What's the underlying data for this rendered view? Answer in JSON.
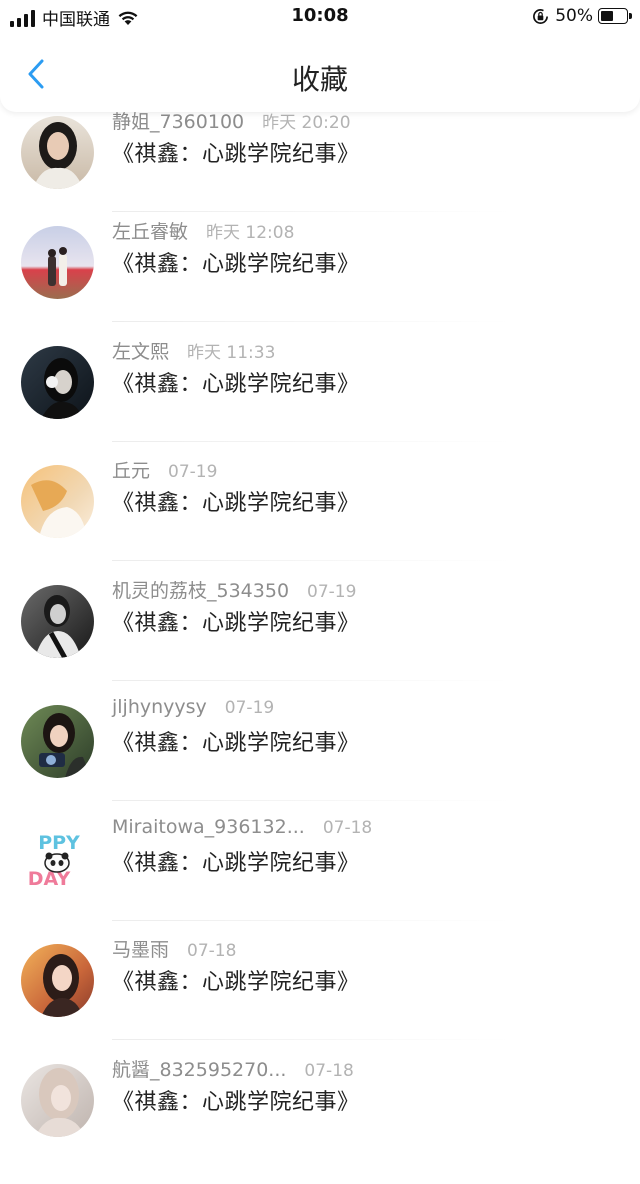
{
  "status_bar": {
    "carrier": "中国联通",
    "time": "10:08",
    "battery_percent": "50%",
    "battery_level": 0.5,
    "icons": [
      "signal-icon",
      "wifi-icon",
      "rotation-lock-icon",
      "battery-icon"
    ]
  },
  "nav": {
    "title": "收藏",
    "back_icon": "chevron-left-icon",
    "accent": "#2b9cf2"
  },
  "favorites": [
    {
      "username": "静姐_7360100",
      "date": "昨天 20:20",
      "title": "《祺鑫：心跳学院纪事》"
    },
    {
      "username": "左丘睿敏",
      "date": "昨天 12:08",
      "title": "《祺鑫：心跳学院纪事》"
    },
    {
      "username": "左文熙",
      "date": "昨天 11:33",
      "title": "《祺鑫：心跳学院纪事》"
    },
    {
      "username": "丘元",
      "date": "07-19",
      "title": "《祺鑫：心跳学院纪事》"
    },
    {
      "username": "机灵的荔枝_534350",
      "date": "07-19",
      "title": "《祺鑫：心跳学院纪事》"
    },
    {
      "username": "jljhynyysy",
      "date": "07-19",
      "title": "《祺鑫：心跳学院纪事》"
    },
    {
      "username": "Miraitowa_936132...",
      "date": "07-18",
      "title": "《祺鑫：心跳学院纪事》",
      "avatar_text": "PPY DAY"
    },
    {
      "username": "马墨雨",
      "date": "07-18",
      "title": "《祺鑫：心跳学院纪事》"
    },
    {
      "username": "航醤_832595270...",
      "date": "07-18",
      "title": "《祺鑫：心跳学院纪事》"
    }
  ]
}
